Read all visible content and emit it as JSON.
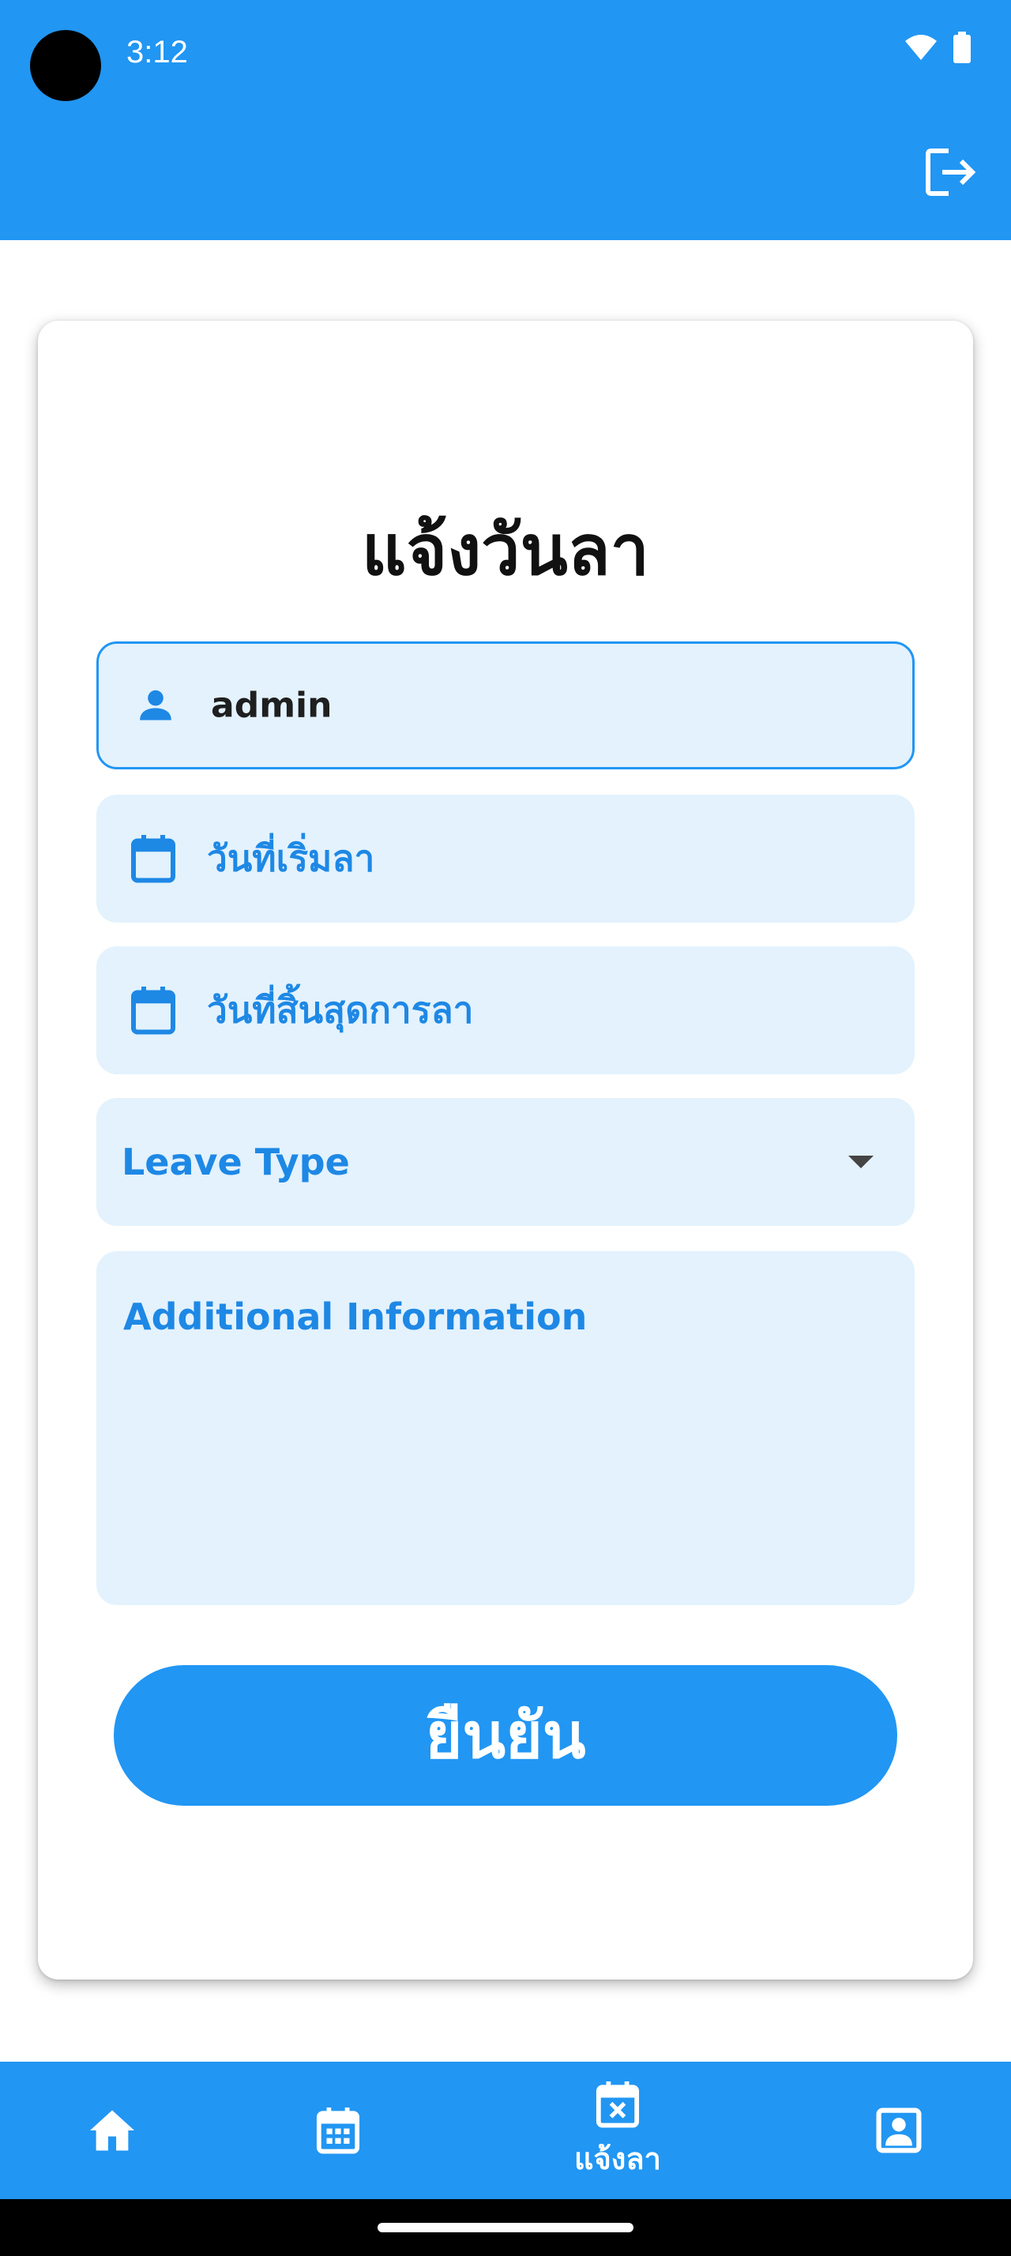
{
  "status_bar": {
    "time": "3:12"
  },
  "header": {
    "logout_icon": "logout-icon"
  },
  "form": {
    "title": "แจ้งวันลา",
    "username_value": "admin",
    "start_date_placeholder": "วันที่เริ่มลา",
    "end_date_placeholder": "วันที่สิ้นสุดการลา",
    "leave_type_placeholder": "Leave Type",
    "additional_info_placeholder": "Additional Information",
    "submit_label": "ยืนยัน"
  },
  "bottom_nav": {
    "items": [
      {
        "icon": "home-icon",
        "label": ""
      },
      {
        "icon": "calendar-icon",
        "label": ""
      },
      {
        "icon": "calendar-cancel-icon",
        "label": "แจ้งลา",
        "active": true
      },
      {
        "icon": "profile-icon",
        "label": ""
      }
    ]
  },
  "colors": {
    "primary": "#2196F3",
    "field_bg": "#E3F2FD",
    "placeholder_text": "#1E88E5"
  }
}
